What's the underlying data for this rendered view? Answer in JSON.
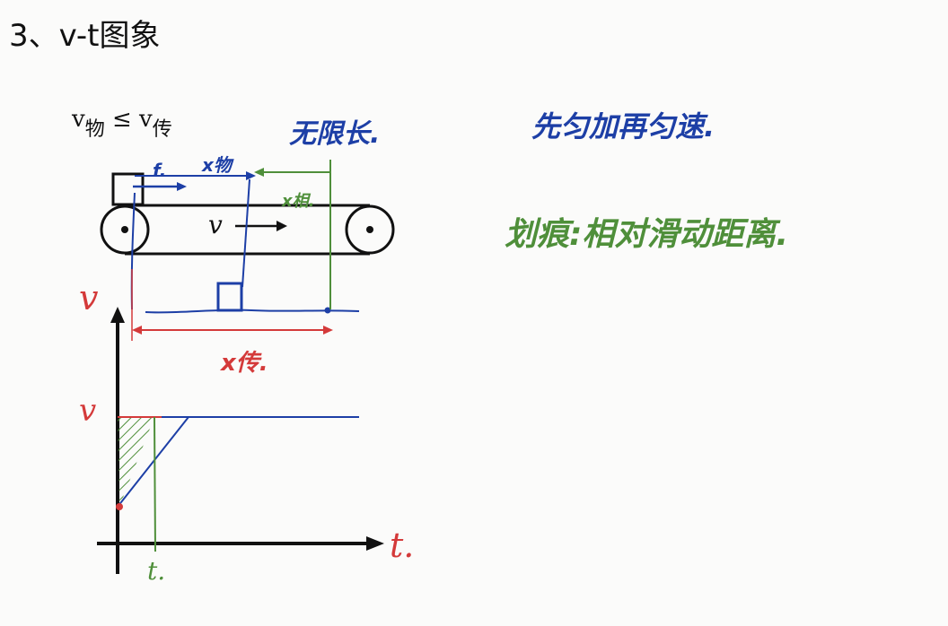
{
  "title": "3、v-t图象",
  "condition": {
    "v_main": "v",
    "sub_object": "物",
    "relation": "≤",
    "sub_belt": "传"
  },
  "notes": {
    "infinite_length": "无限长.",
    "motion": "先匀加再匀速.",
    "scratch": "划痕:相对滑动距离."
  },
  "labels": {
    "friction": "f.",
    "x_object": "x物",
    "x_relative": "x相.",
    "belt_velocity": "v",
    "x_belt": "x传.",
    "axis_v": "v",
    "v_level": "v",
    "axis_t": "t.",
    "time_t": "t."
  },
  "colors": {
    "ink": "#111111",
    "blue": "#1d3fa6",
    "green": "#4f8f3a",
    "red": "#d43a3a"
  }
}
